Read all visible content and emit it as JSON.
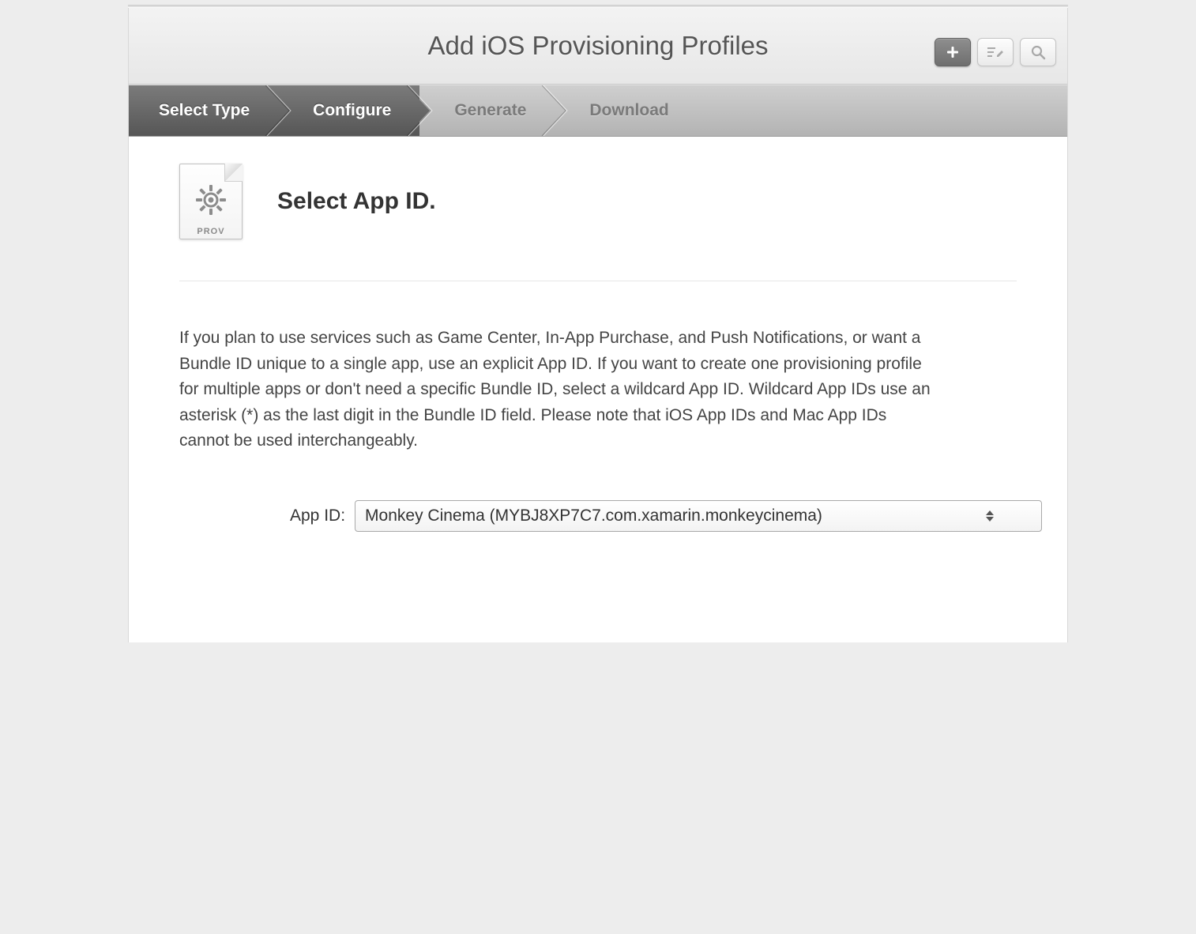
{
  "header": {
    "title": "Add iOS Provisioning Profiles"
  },
  "tools": {
    "add": "add",
    "edit": "edit",
    "search": "search"
  },
  "steps": [
    {
      "label": "Select Type",
      "active": true
    },
    {
      "label": "Configure",
      "active": true
    },
    {
      "label": "Generate",
      "active": false
    },
    {
      "label": "Download",
      "active": false
    }
  ],
  "section": {
    "icon_caption": "PROV",
    "title": "Select App ID.",
    "description": "If you plan to use services such as Game Center, In-App Purchase, and Push Notifications, or want a Bundle ID unique to a single app, use an explicit App ID. If you want to create one provisioning profile for multiple apps or don't need a specific Bundle ID, select a wildcard App ID. Wildcard App IDs use an asterisk (*) as the last digit in the Bundle ID field. Please note that iOS App IDs and Mac App IDs cannot be used interchangeably."
  },
  "form": {
    "app_id_label": "App ID:",
    "app_id_value": "Monkey Cinema (MYBJ8XP7C7.com.xamarin.monkeycinema)"
  }
}
